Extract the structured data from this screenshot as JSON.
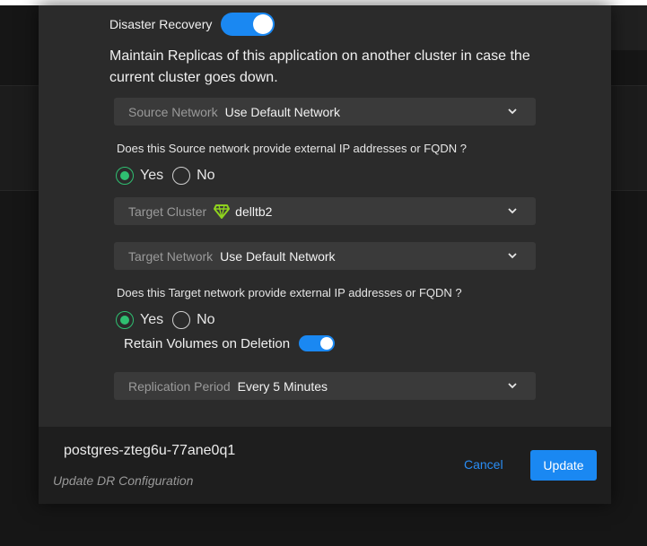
{
  "dr": {
    "label": "Disaster Recovery",
    "enabled": true,
    "description": "Maintain Replicas of this application on another cluster in case the current cluster goes down."
  },
  "source_network": {
    "label": "Source Network",
    "value": "Use Default Network"
  },
  "source_question": "Does this Source network provide external IP addresses or FQDN ?",
  "source_radio": {
    "yes": "Yes",
    "no": "No",
    "selected": "Yes"
  },
  "target_cluster": {
    "label": "Target Cluster",
    "value": "delltb2",
    "icon": "cluster-diamond-icon",
    "icon_color": "#8fd21e"
  },
  "target_network": {
    "label": "Target Network",
    "value": "Use Default Network"
  },
  "target_question": "Does this Target network provide external IP addresses or FQDN ?",
  "target_radio": {
    "yes": "Yes",
    "no": "No",
    "selected": "Yes"
  },
  "retain": {
    "label": "Retain Volumes on Deletion",
    "enabled": true
  },
  "replication_period": {
    "label": "Replication Period",
    "value": "Every 5 Minutes"
  },
  "footer": {
    "app_name": "postgres-zteg6u-77ane0q1",
    "subtitle": "Update DR Configuration",
    "cancel_label": "Cancel",
    "update_label": "Update"
  },
  "colors": {
    "accent": "#1a88f2",
    "radio_selected": "#2fbf71"
  }
}
